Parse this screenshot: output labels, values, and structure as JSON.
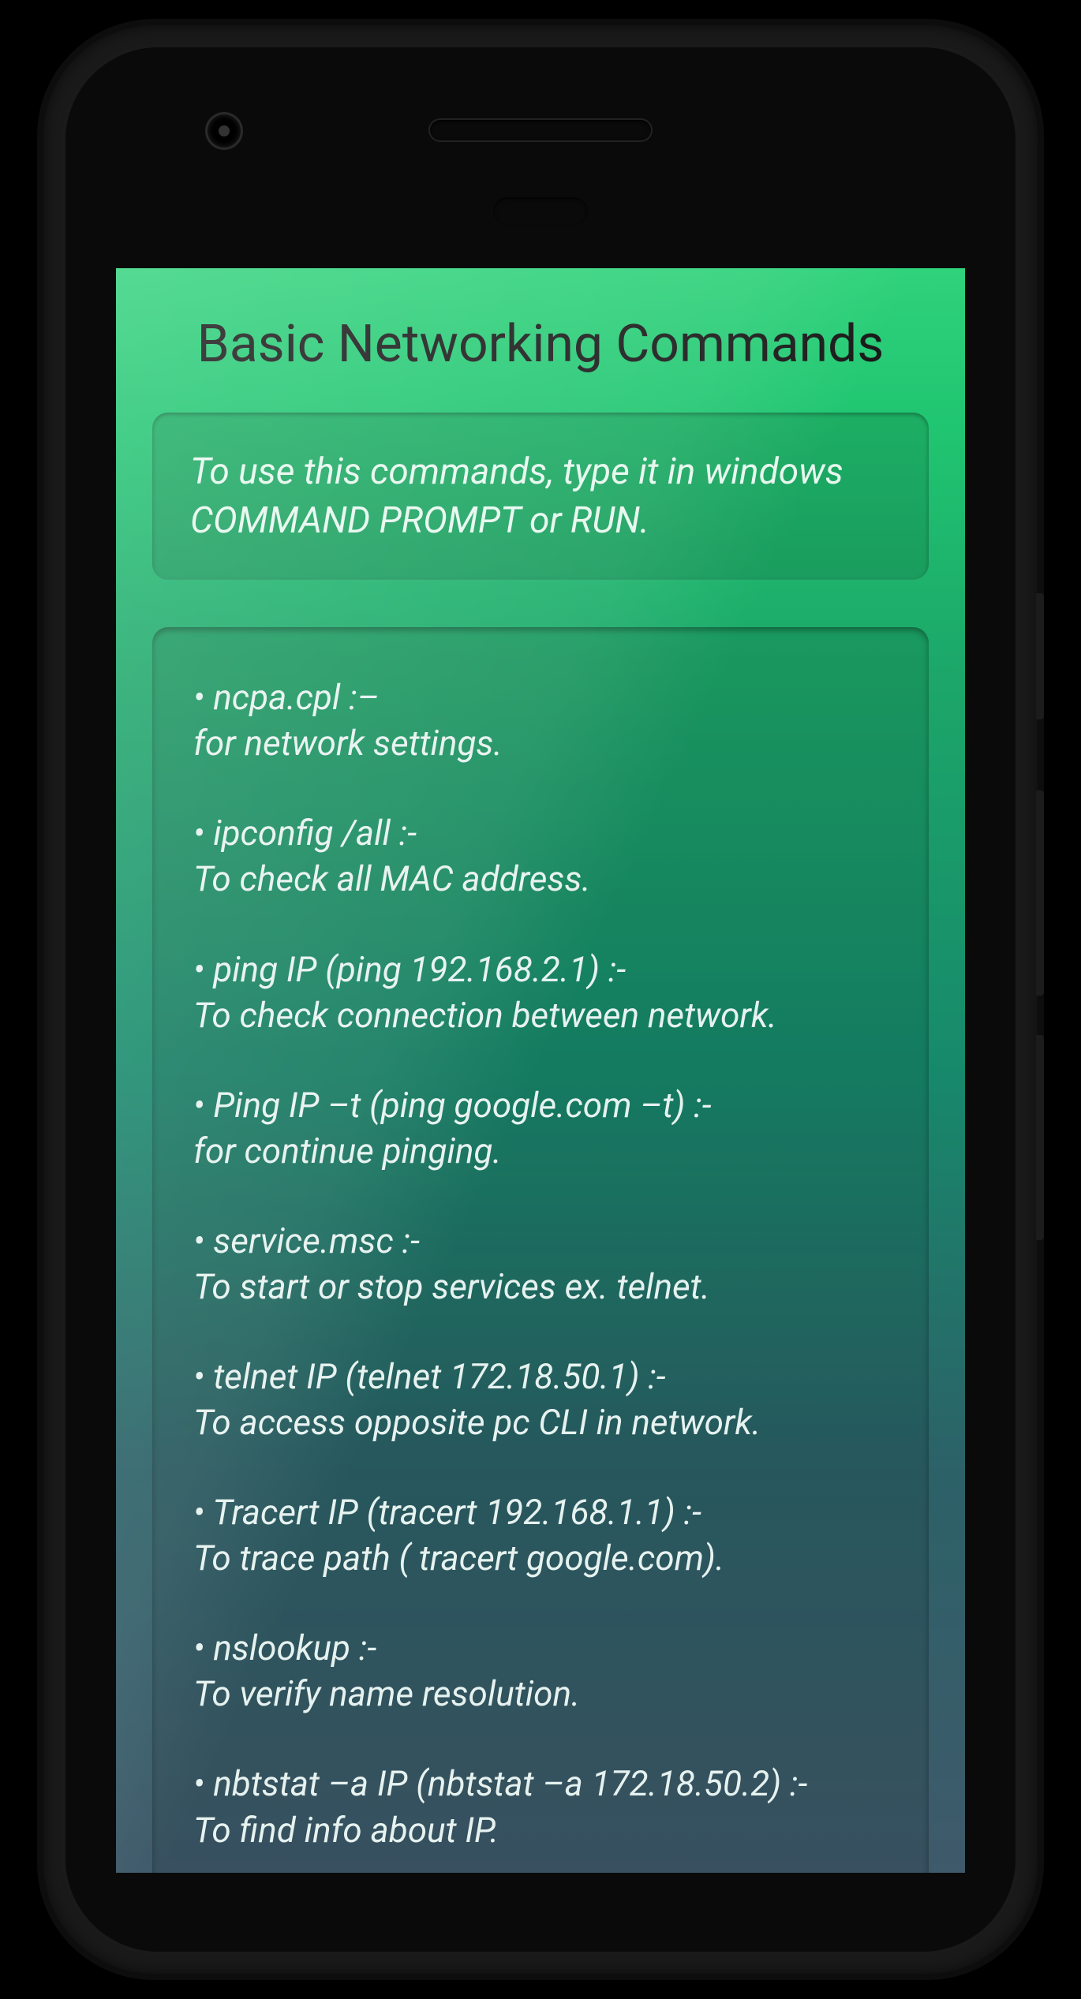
{
  "app": {
    "title": "Basic Networking Commands"
  },
  "intro": {
    "text": "To use this commands, type it in windows COMMAND PROMPT or RUN."
  },
  "commands": [
    {
      "cmd": "• ncpa.cpl :–",
      "desc": "for network settings."
    },
    {
      "cmd": "• ipconfig /all :-",
      "desc": "To check all MAC address."
    },
    {
      "cmd": "• ping IP (ping 192.168.2.1) :-",
      "desc": " To check connection between network."
    },
    {
      "cmd": "• Ping IP –t (ping google.com –t) :-",
      "desc": "for continue pinging."
    },
    {
      "cmd": "• service.msc :-",
      "desc": "To start or stop services ex. telnet."
    },
    {
      "cmd": "• telnet IP (telnet 172.18.50.1) :-",
      "desc": "To access opposite pc CLI in network."
    },
    {
      "cmd": "• Tracert IP (tracert 192.168.1.1) :-",
      "desc": "To trace path ( tracert google.com)."
    },
    {
      "cmd": "• nslookup :-",
      "desc": "To verify name resolution."
    },
    {
      "cmd": "• nbtstat –a IP (nbtstat –a 172.18.50.2) :-",
      "desc": "To find info about IP."
    }
  ]
}
